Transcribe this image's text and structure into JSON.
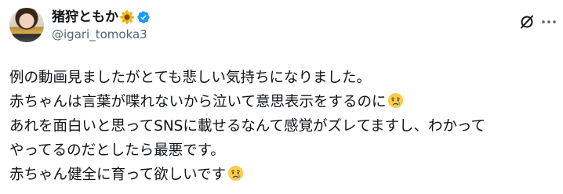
{
  "author": {
    "display_name": "猪狩ともか",
    "name_emoji": "sunflower-icon",
    "verified": true,
    "handle": "@igari_tomoka3"
  },
  "actions": {
    "grok_icon": "grok-icon",
    "more_icon": "more-icon"
  },
  "tweet": {
    "lines": [
      "例の動画見ましたがとても悲しい気持ちになりました。",
      "赤ちゃんは言葉が喋れないから泣いて意思表示をするのに",
      "あれを面白いと思ってSNSに載せるなんて感覚がズレてますし、わかって",
      "やってるのだとしたら最悪です。",
      "赤ちゃん健全に育って欲しいです"
    ],
    "line_emojis": [
      "",
      "crying-face-icon",
      "",
      "",
      "crying-face-icon"
    ]
  },
  "colors": {
    "text": "#0f1419",
    "secondary": "#536471",
    "verified": "#1d9bf0"
  }
}
